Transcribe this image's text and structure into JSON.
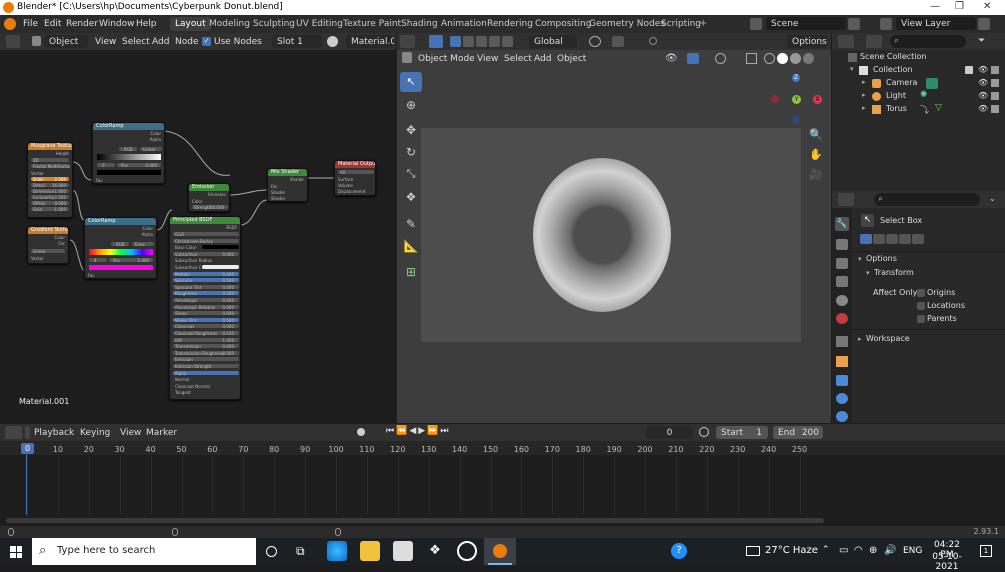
{
  "window": {
    "title": "Blender* [C:\\Users\\hp\\Documents\\Cyberpunk Donut.blend]"
  },
  "menu": [
    "File",
    "Edit",
    "Render",
    "Window",
    "Help"
  ],
  "workspaces": [
    "Layout",
    "Modeling",
    "Sculpting",
    "UV Editing",
    "Texture Paint",
    "Shading",
    "Animation",
    "Rendering",
    "Compositing",
    "Geometry Nodes",
    "Scripting"
  ],
  "scene": {
    "name": "Scene",
    "view_layer": "View Layer"
  },
  "node_editor": {
    "mode": "Object",
    "menus": [
      "View",
      "Select",
      "Add",
      "Node"
    ],
    "use_nodes": "Use Nodes",
    "slot": "Slot 1",
    "material": "Material.001",
    "label": "Material.001",
    "nodes": {
      "musgrave": {
        "title": "Musgrave Texture",
        "rows": [
          "Height",
          "3D",
          "Fractal Multifractal",
          "Vector",
          "Scale",
          "Detail",
          "Dimension",
          "Lacunarity",
          "Offset",
          "Gain"
        ],
        "values": [
          "2.500",
          "16.000",
          "1.600",
          "2.500",
          "0.000",
          "1.000"
        ]
      },
      "colorramp1": {
        "title": "ColorRamp",
        "rows": [
          "Color",
          "Alpha",
          "RGB",
          "Linear",
          "Pos",
          "Fac"
        ],
        "values": [
          "0",
          "0.000"
        ]
      },
      "gradient": {
        "title": "Gradient Texture",
        "rows": [
          "Color",
          "Fac",
          "Linear",
          "Vector"
        ]
      },
      "colorramp2": {
        "title": "ColorRamp",
        "rows": [
          "Color",
          "Alpha",
          "RGB",
          "Ease",
          "Pos",
          "Fac"
        ],
        "values": [
          "4",
          "1.000"
        ]
      },
      "emission": {
        "title": "Emission",
        "rows": [
          "Emission",
          "Color",
          "Strength"
        ],
        "values": [
          "10.000"
        ]
      },
      "mixshader": {
        "title": "Mix Shader",
        "rows": [
          "Shader",
          "Fac",
          "Shader",
          "Shader"
        ]
      },
      "output": {
        "title": "Material Output",
        "rows": [
          "All",
          "Surface",
          "Volume",
          "Displacement"
        ]
      },
      "principled": {
        "title": "Principled BSDF",
        "header": "BSDF",
        "rows": [
          "GGX",
          "Christensen-Burley",
          "Base Color",
          "Subsurface",
          "Subsurface Radius",
          "Subsurface C...",
          "Metallic",
          "Specular",
          "Specular Tint",
          "Roughness",
          "Anisotropic",
          "Anisotropic Rotation",
          "Sheen",
          "Sheen Tint",
          "Clearcoat",
          "Clearcoat Roughness",
          "IOR",
          "Transmission",
          "Transmission Roughness",
          "Emission",
          "Emission Strength",
          "Alpha",
          "Normal",
          "Clearcoat Normal",
          "Tangent"
        ],
        "values": [
          "0.000",
          "0.000",
          "0.500",
          "0.000",
          "0.500",
          "0.000",
          "0.000",
          "0.000",
          "0.500",
          "0.000",
          "0.030",
          "1.450",
          "0.000",
          "0.000",
          "1.000",
          "1.000"
        ]
      }
    }
  },
  "viewport": {
    "mode": "Object Mode",
    "menus": [
      "View",
      "Select",
      "Add",
      "Object"
    ],
    "orientation": "Global",
    "options": "Options",
    "gizmo": {
      "x": "X",
      "y": "Y",
      "z": "Z"
    }
  },
  "outliner": {
    "scene_collection": "Scene Collection",
    "collection": "Collection",
    "items": [
      {
        "name": "Camera"
      },
      {
        "name": "Light"
      },
      {
        "name": "Torus"
      }
    ]
  },
  "properties": {
    "tool": "Select Box",
    "options_section": "Options",
    "transform_section": "Transform",
    "affect_only": "Affect Only",
    "checks": [
      "Origins",
      "Locations",
      "Parents"
    ],
    "workspace_section": "Workspace"
  },
  "timeline": {
    "menus": [
      "Playback",
      "Keying",
      "View",
      "Marker"
    ],
    "current_frame": "0",
    "start_label": "Start",
    "start": "1",
    "end_label": "End",
    "end": "200",
    "ticks": [
      "0",
      "10",
      "20",
      "30",
      "40",
      "50",
      "60",
      "70",
      "80",
      "90",
      "100",
      "110",
      "120",
      "130",
      "140",
      "150",
      "160",
      "170",
      "180",
      "190",
      "200",
      "210",
      "220",
      "230",
      "240",
      "250"
    ]
  },
  "status": {
    "version": "2.93.1"
  },
  "taskbar": {
    "search_placeholder": "Type here to search",
    "weather": "27°C  Haze",
    "lang": "ENG",
    "time": "04:22 PM",
    "date": "05-10-2021"
  },
  "colors": {
    "accent": "#4772b3",
    "active_blue": "#4f7cd4",
    "orange": "#e87d0d",
    "header_bg": "#303030"
  }
}
